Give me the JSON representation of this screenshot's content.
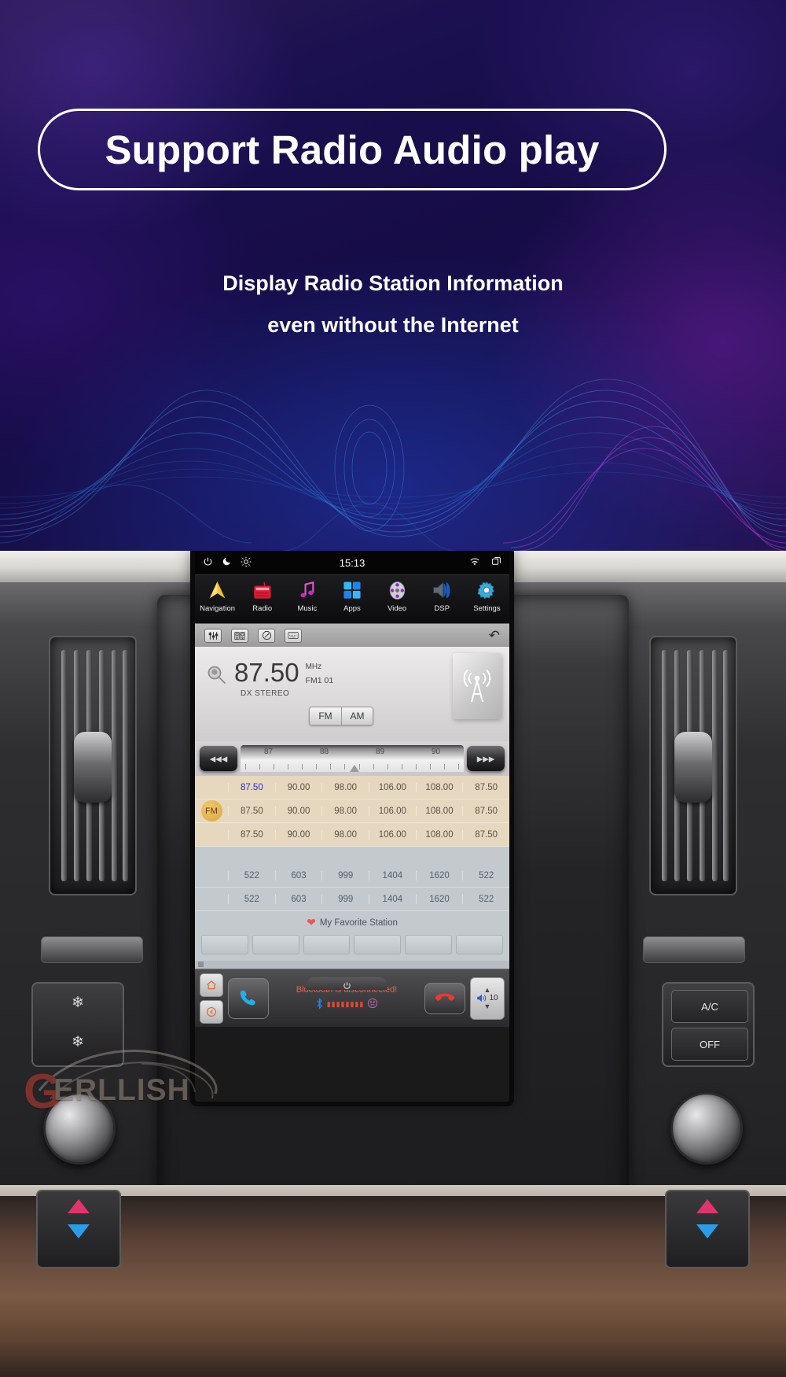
{
  "promo": {
    "headline": "Support Radio Audio play",
    "subtitle_line1": "Display Radio Station Information",
    "subtitle_line2": "even without the Internet"
  },
  "colors": {
    "banner_bg": "#1b1050",
    "accent_blue": "#2b9ce8",
    "accent_purple": "#8d35c9",
    "heart_red": "#f0564f",
    "bt_red": "#f25c4a",
    "preset_active": "#2b2bd4",
    "fm_badge": "#d9a646"
  },
  "head_unit": {
    "status_bar": {
      "power_icon": "power-icon",
      "night_icon": "moon-icon",
      "brightness_icon": "brightness-icon",
      "time": "15:13",
      "wifi_icon": "wifi-icon",
      "apps_icon": "recent-apps-icon"
    },
    "app_row": [
      {
        "label": "Navigation",
        "icon": "navigation-arrow-icon"
      },
      {
        "label": "Radio",
        "icon": "radio-icon"
      },
      {
        "label": "Music",
        "icon": "music-note-icon"
      },
      {
        "label": "Apps",
        "icon": "grid-apps-icon"
      },
      {
        "label": "Video",
        "icon": "film-reel-icon"
      },
      {
        "label": "DSP",
        "icon": "speaker-icon"
      },
      {
        "label": "Settings",
        "icon": "gear-icon"
      }
    ],
    "toolbar": {
      "equalizer_icon": "equalizer-icon",
      "stereo_icon": "stereo-speaker-icon",
      "scan_icon": "scan-dial-icon",
      "keyboard_icon": "keyboard-icon",
      "back_icon": "back-arrow-icon"
    },
    "radio": {
      "search_icon": "magnifier-icon",
      "frequency": "87.50",
      "unit": "MHz",
      "band_preset": "FM1  01",
      "mode_line": "DX  STEREO",
      "band_buttons": [
        "FM",
        "AM"
      ],
      "antenna_icon": "antenna-tower-icon",
      "seek_prev_icon": "seek-backward-icon",
      "seek_next_icon": "seek-forward-icon",
      "scale_ticks": [
        "87",
        "88",
        "89",
        "90"
      ],
      "fm_presets": [
        [
          "87.50",
          "90.00",
          "98.00",
          "106.00",
          "108.00",
          "87.50"
        ],
        [
          "87.50",
          "90.00",
          "98.00",
          "106.00",
          "108.00",
          "87.50"
        ],
        [
          "87.50",
          "90.00",
          "98.00",
          "106.00",
          "108.00",
          "87.50"
        ]
      ],
      "fm_active_cell": "87.50",
      "fm_badge": "FM",
      "am_presets": [
        [
          "522",
          "603",
          "999",
          "1404",
          "1620",
          "522"
        ],
        [
          "522",
          "603",
          "999",
          "1404",
          "1620",
          "522"
        ]
      ],
      "favorites_label": "My Favorite Station",
      "favorites_slot_count": 6
    },
    "dock": {
      "home_icon": "home-icon",
      "back_icon": "back-circle-icon",
      "phone_icon": "phone-call-icon",
      "power_icon": "power-icon",
      "bluetooth_message": "Bluetooth is disconnected!",
      "bluetooth_icon": "bluetooth-icon",
      "signal_dots": "▮▮▮▮▮▮▮▮",
      "sad_face_icon": "sad-face-icon",
      "hangup_icon": "hangup-icon",
      "volume_icon": "volume-icon",
      "volume_value": "10",
      "vol_up_icon": "chevron-up-icon",
      "vol_down_icon": "chevron-down-icon"
    }
  },
  "dashboard": {
    "ac_button": "A/C",
    "off_button": "OFF",
    "fan_icon": "fan-icon",
    "temp_up_icon": "triangle-up-icon",
    "temp_down_icon": "triangle-down-icon"
  },
  "watermark": {
    "brand_initial": "G",
    "brand_rest": "ERLLISH"
  }
}
